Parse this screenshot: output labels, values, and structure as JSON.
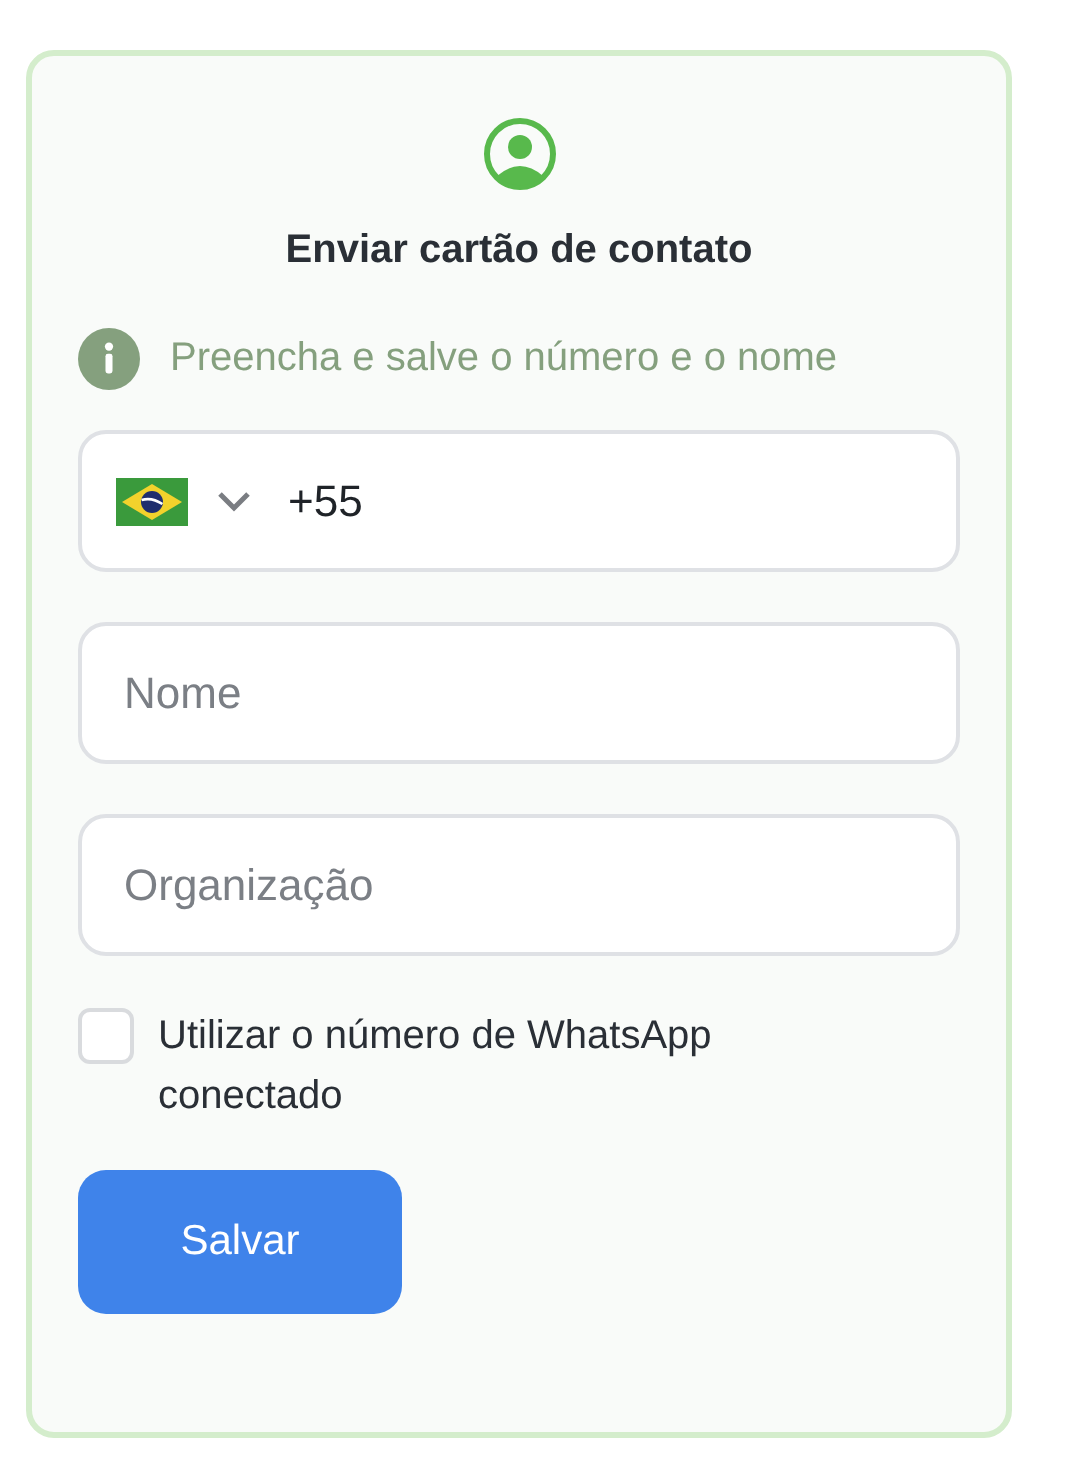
{
  "card": {
    "title": "Enviar cartão de contato",
    "info": "Preencha e salve o número e o nome"
  },
  "phone": {
    "country_code": "+55"
  },
  "fields": [
    {
      "placeholder": "Nome"
    },
    {
      "placeholder": "Organização"
    }
  ],
  "use_connected_number": {
    "label": "Utilizar o número de WhatsApp conectado",
    "checked": false
  },
  "buttons": [
    "Salvar"
  ]
}
